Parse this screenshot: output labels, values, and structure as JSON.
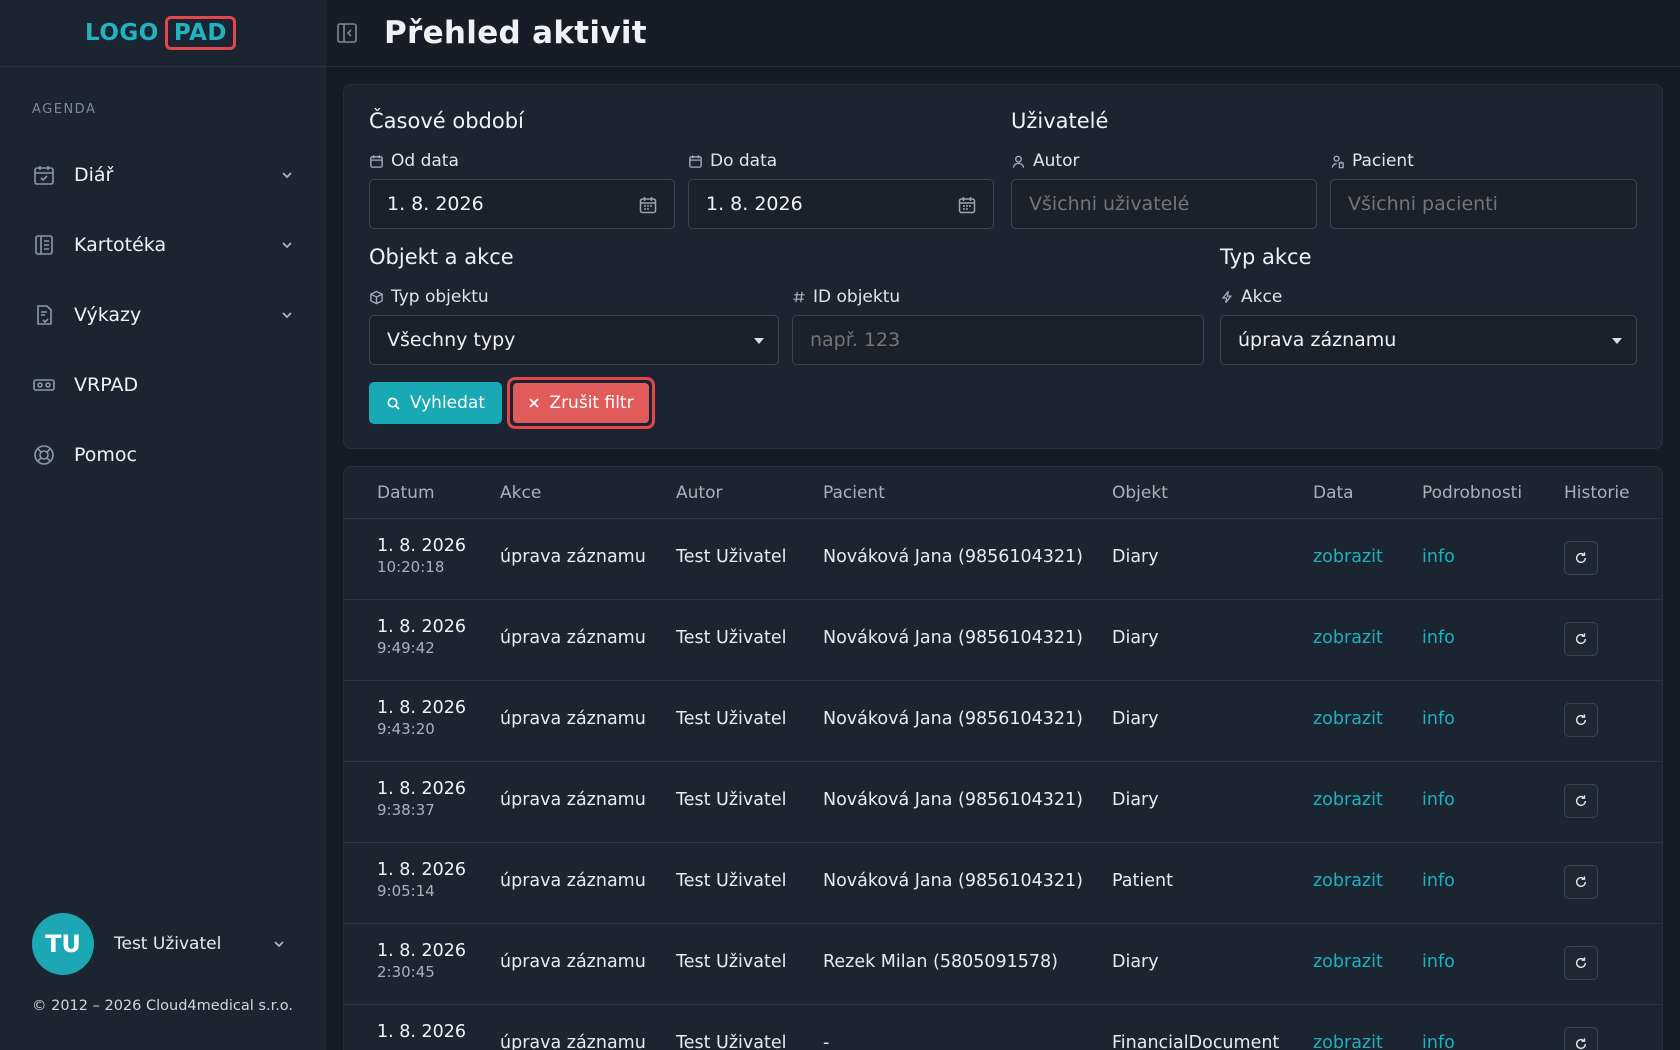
{
  "logo": {
    "part1": "LOGO",
    "part2": "PAD"
  },
  "sidebar": {
    "section": "AGENDA",
    "items": [
      {
        "label": "Diář",
        "icon": "calendar-check-icon",
        "expandable": true
      },
      {
        "label": "Kartotéka",
        "icon": "card-index-icon",
        "expandable": true
      },
      {
        "label": "Výkazy",
        "icon": "report-icon",
        "expandable": true
      },
      {
        "label": "VRPAD",
        "icon": "vr-headset-icon",
        "expandable": false
      },
      {
        "label": "Pomoc",
        "icon": "lifebuoy-icon",
        "expandable": false
      }
    ],
    "user": {
      "initials": "TU",
      "name": "Test Uživatel"
    },
    "copyright": "© 2012 – 2026 Cloud4medical s.r.o."
  },
  "header": {
    "title": "Přehled aktivit"
  },
  "filters": {
    "time_group": "Časové období",
    "from_label": "Od data",
    "from_value": "1. 8. 2026",
    "to_label": "Do data",
    "to_value": "1. 8. 2026",
    "users_group": "Uživatelé",
    "author_label": "Autor",
    "author_placeholder": "Všichni uživatelé",
    "patient_label": "Pacient",
    "patient_placeholder": "Všichni pacienti",
    "object_group": "Objekt a akce",
    "object_type_label": "Typ objektu",
    "object_type_value": "Všechny typy",
    "object_id_label": "ID objektu",
    "object_id_placeholder": "např. 123",
    "action_group": "Typ akce",
    "action_label": "Akce",
    "action_value": "úprava záznamu",
    "search_btn": "Vyhledat",
    "clear_btn": "Zrušit filtr"
  },
  "table": {
    "headers": [
      "Datum",
      "Akce",
      "Autor",
      "Pacient",
      "Objekt",
      "Data",
      "Podrobnosti",
      "Historie"
    ],
    "rows": [
      {
        "date": "1. 8. 2026",
        "time": "10:20:18",
        "action": "úprava záznamu",
        "author": "Test Uživatel",
        "patient": "Nováková Jana (9856104321)",
        "object": "Diary",
        "data": "zobrazit",
        "details": "info"
      },
      {
        "date": "1. 8. 2026",
        "time": "9:49:42",
        "action": "úprava záznamu",
        "author": "Test Uživatel",
        "patient": "Nováková Jana (9856104321)",
        "object": "Diary",
        "data": "zobrazit",
        "details": "info"
      },
      {
        "date": "1. 8. 2026",
        "time": "9:43:20",
        "action": "úprava záznamu",
        "author": "Test Uživatel",
        "patient": "Nováková Jana (9856104321)",
        "object": "Diary",
        "data": "zobrazit",
        "details": "info"
      },
      {
        "date": "1. 8. 2026",
        "time": "9:38:37",
        "action": "úprava záznamu",
        "author": "Test Uživatel",
        "patient": "Nováková Jana (9856104321)",
        "object": "Diary",
        "data": "zobrazit",
        "details": "info"
      },
      {
        "date": "1. 8. 2026",
        "time": "9:05:14",
        "action": "úprava záznamu",
        "author": "Test Uživatel",
        "patient": "Nováková Jana (9856104321)",
        "object": "Patient",
        "data": "zobrazit",
        "details": "info"
      },
      {
        "date": "1. 8. 2026",
        "time": "2:30:45",
        "action": "úprava záznamu",
        "author": "Test Uživatel",
        "patient": "Rezek Milan (5805091578)",
        "object": "Diary",
        "data": "zobrazit",
        "details": "info"
      },
      {
        "date": "1. 8. 2026",
        "time": "",
        "action": "úprava záznamu",
        "author": "Test Uživatel",
        "patient": "-",
        "object": "FinancialDocument",
        "data": "zobrazit",
        "details": "info"
      }
    ]
  },
  "colors": {
    "accent": "#19a9b5",
    "danger": "#e25b5b",
    "highlight": "#e0484b"
  }
}
